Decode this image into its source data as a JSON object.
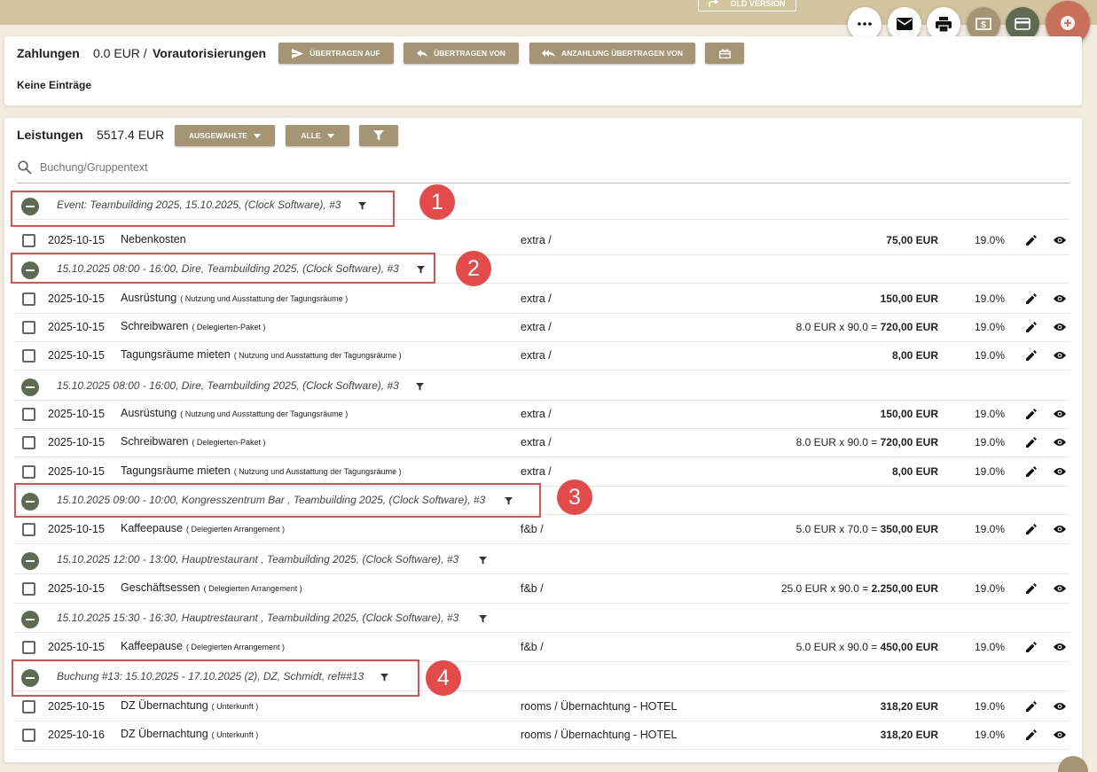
{
  "header": {
    "old_version_label": "OLD VERSION"
  },
  "fabs": [
    {
      "name": "more-icon"
    },
    {
      "name": "mail-icon"
    },
    {
      "name": "print-icon"
    },
    {
      "name": "money-icon"
    },
    {
      "name": "card-icon"
    },
    {
      "name": "add-icon"
    }
  ],
  "payments": {
    "title": "Zahlungen",
    "amount": "0.0 EUR /",
    "preauth_label": "Vorautorisierungen",
    "btn_transfer_to": "ÜBERTRAGEN AUF",
    "btn_transfer_from": "ÜBERTRAGEN VON",
    "btn_deposit_from": "ANZAHLUNG ÜBERTRAGEN VON",
    "empty": "Keine Einträge"
  },
  "services": {
    "title": "Leistungen",
    "total": "5517.4 EUR",
    "btn_selected": "AUSGEWÄHLTE",
    "btn_all": "ALLE",
    "search_placeholder": "Buchung/Gruppentext"
  },
  "rows": [
    {
      "type": "group",
      "text": "Event: Teambuilding 2025, 15.10.2025, (Clock Software), #3"
    },
    {
      "type": "item",
      "date": "2025-10-15",
      "name": "Nebenkosten",
      "sub": "",
      "cat": "extra /",
      "calc": "",
      "amount": "75,00 EUR",
      "vat": "19.0%"
    },
    {
      "type": "group",
      "text": "15.10.2025 08:00 - 16:00, Dire, Teambuilding 2025, (Clock Software), #3"
    },
    {
      "type": "item",
      "date": "2025-10-15",
      "name": "Ausrüstung",
      "sub": "( Nutzung und Ausstattung der Tagungsräume )",
      "cat": "extra /",
      "calc": "",
      "amount": "150,00 EUR",
      "vat": "19.0%"
    },
    {
      "type": "item",
      "date": "2025-10-15",
      "name": "Schreibwaren",
      "sub": "( Delegierten-Paket )",
      "cat": "extra /",
      "calc": "8.0 EUR x 90.0 =",
      "amount": "720,00 EUR",
      "vat": "19.0%"
    },
    {
      "type": "item",
      "date": "2025-10-15",
      "name": "Tagungsräume mieten",
      "sub": "( Nutzung und Ausstattung der Tagungsräume )",
      "cat": "extra /",
      "calc": "",
      "amount": "8,00 EUR",
      "vat": "19.0%"
    },
    {
      "type": "group",
      "text": "15.10.2025 08:00 - 16:00, Dire, Teambuilding 2025, (Clock Software), #3"
    },
    {
      "type": "item",
      "date": "2025-10-15",
      "name": "Ausrüstung",
      "sub": "( Nutzung und Ausstattung der Tagungsräume )",
      "cat": "extra /",
      "calc": "",
      "amount": "150,00 EUR",
      "vat": "19.0%"
    },
    {
      "type": "item",
      "date": "2025-10-15",
      "name": "Schreibwaren",
      "sub": "( Delegierten-Paket )",
      "cat": "extra /",
      "calc": "8.0 EUR x 90.0 =",
      "amount": "720,00 EUR",
      "vat": "19.0%"
    },
    {
      "type": "item",
      "date": "2025-10-15",
      "name": "Tagungsräume mieten",
      "sub": "( Nutzung und Ausstattung der Tagungsräume )",
      "cat": "extra /",
      "calc": "",
      "amount": "8,00 EUR",
      "vat": "19.0%"
    },
    {
      "type": "group",
      "text": "15.10.2025 09:00 - 10:00, Kongresszentrum Bar , Teambuilding 2025, (Clock Software), #3"
    },
    {
      "type": "item",
      "date": "2025-10-15",
      "name": "Kaffeepause",
      "sub": "( Delegierten Arrangement )",
      "cat": "f&b /",
      "calc": "5.0 EUR x 70.0 =",
      "amount": "350,00 EUR",
      "vat": "19.0%"
    },
    {
      "type": "group",
      "text": "15.10.2025 12:00 - 13:00, Hauptrestaurant , Teambuilding 2025, (Clock Software), #3"
    },
    {
      "type": "item",
      "date": "2025-10-15",
      "name": "Geschäftsessen",
      "sub": "( Delegierten Arrangement )",
      "cat": "f&b /",
      "calc": "25.0 EUR x 90.0 =",
      "amount": "2.250,00 EUR",
      "vat": "19.0%"
    },
    {
      "type": "group",
      "text": "15.10.2025 15:30 - 16:30, Hauptrestaurant , Teambuilding 2025, (Clock Software), #3"
    },
    {
      "type": "item",
      "date": "2025-10-15",
      "name": "Kaffeepause",
      "sub": "( Delegierten Arrangement )",
      "cat": "f&b /",
      "calc": "5.0 EUR x 90.0 =",
      "amount": "450,00 EUR",
      "vat": "19.0%"
    },
    {
      "type": "group",
      "text": "Buchung #13: 15.10.2025 - 17.10.2025 (2), DZ, Schmidt, ref##13"
    },
    {
      "type": "item",
      "date": "2025-10-15",
      "name": "DZ Übernachtung",
      "sub": "( Unterkunft )",
      "cat": "rooms / Übernachtung - HOTEL",
      "calc": "",
      "amount": "318,20 EUR",
      "vat": "19.0%"
    },
    {
      "type": "item",
      "date": "2025-10-16",
      "name": "DZ Übernachtung",
      "sub": "( Unterkunft )",
      "cat": "rooms / Übernachtung - HOTEL",
      "calc": "",
      "amount": "318,20 EUR",
      "vat": "19.0%"
    }
  ],
  "markers": [
    "1",
    "2",
    "3",
    "4"
  ]
}
